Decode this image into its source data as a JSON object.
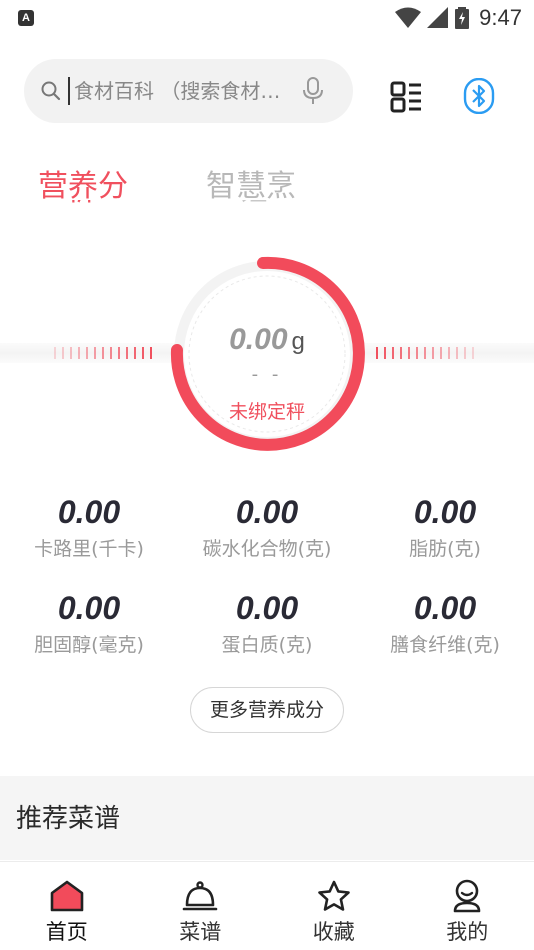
{
  "status_bar": {
    "app_icon_letter": "A",
    "time": "9:47"
  },
  "search": {
    "placeholder": "食材百科 （搜索食材…"
  },
  "tabs": [
    {
      "label": "营养分析",
      "visible_text": "营养分",
      "active": true
    },
    {
      "label": "智慧烹饪",
      "visible_text": "智慧烹",
      "active": false
    }
  ],
  "scale": {
    "weight": "0.00",
    "unit": "g",
    "secondary": "- -",
    "status": "未绑定秤",
    "accent_color": "#f0505e"
  },
  "nutrition": [
    {
      "value": "0.00",
      "label": "卡路里(千卡)"
    },
    {
      "value": "0.00",
      "label": "碳水化合物(克)"
    },
    {
      "value": "0.00",
      "label": "脂肪(克)"
    },
    {
      "value": "0.00",
      "label": "胆固醇(毫克)"
    },
    {
      "value": "0.00",
      "label": "蛋白质(克)"
    },
    {
      "value": "0.00",
      "label": "膳食纤维(克)"
    }
  ],
  "more_button": "更多营养成分",
  "recommend": {
    "title": "推荐菜谱"
  },
  "bottom_nav": [
    {
      "label": "首页",
      "icon": "home-icon",
      "active": true
    },
    {
      "label": "菜谱",
      "icon": "cloche-icon",
      "active": false
    },
    {
      "label": "收藏",
      "icon": "star-icon",
      "active": false
    },
    {
      "label": "我的",
      "icon": "profile-icon",
      "active": false
    }
  ]
}
